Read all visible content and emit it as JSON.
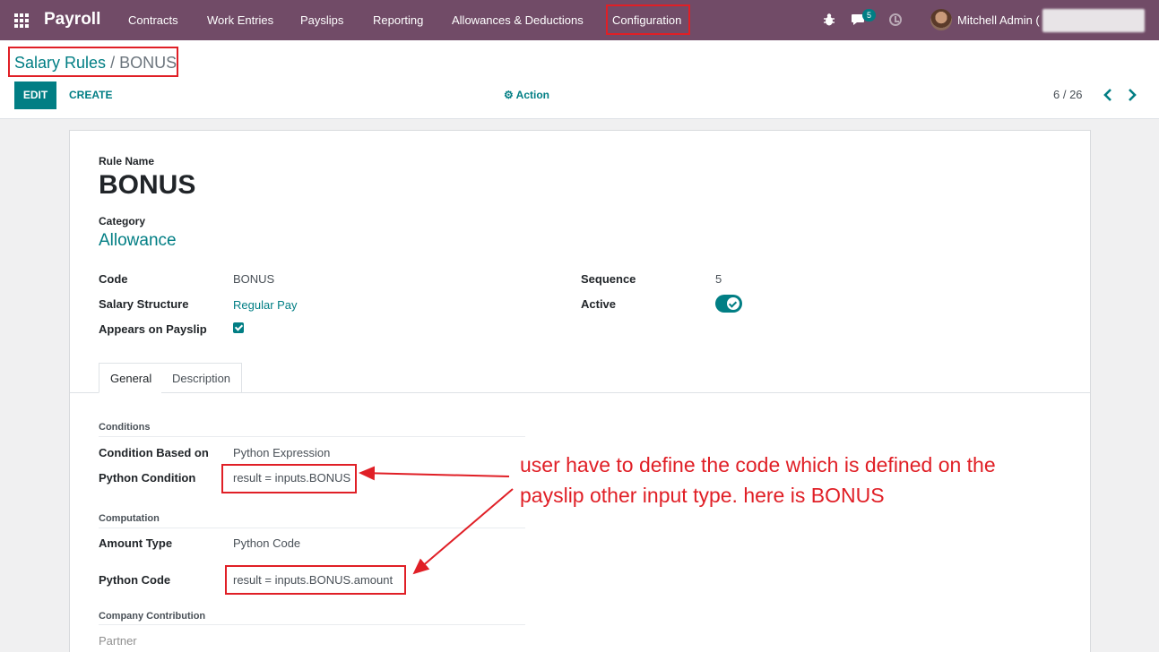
{
  "navbar": {
    "brand": "Payroll",
    "menu": [
      "Contracts",
      "Work Entries",
      "Payslips",
      "Reporting",
      "Allowances & Deductions",
      "Configuration"
    ],
    "message_count": "5",
    "user": "Mitchell Admin ("
  },
  "control_panel": {
    "breadcrumb_parent": "Salary Rules",
    "breadcrumb_sep": "/",
    "breadcrumb_current": "BONUS",
    "edit_label": "EDIT",
    "create_label": "CREATE",
    "action_label": "Action",
    "pager": "6 / 26"
  },
  "form": {
    "rule_name_label": "Rule Name",
    "rule_name": "BONUS",
    "category_label": "Category",
    "category": "Allowance",
    "code_label": "Code",
    "code": "BONUS",
    "structure_label": "Salary Structure",
    "structure": "Regular Pay",
    "appears_label": "Appears on Payslip",
    "appears_checked": true,
    "sequence_label": "Sequence",
    "sequence": "5",
    "active_label": "Active",
    "active": true
  },
  "tabs": [
    "General",
    "Description"
  ],
  "general": {
    "conditions_head": "Conditions",
    "condition_based_label": "Condition Based on",
    "condition_based": "Python Expression",
    "python_condition_label": "Python Condition",
    "python_condition": "result = inputs.BONUS",
    "computation_head": "Computation",
    "amount_type_label": "Amount Type",
    "amount_type": "Python Code",
    "python_code_label": "Python Code",
    "python_code": "result = inputs.BONUS.amount",
    "company_head": "Company Contribution",
    "partner_label": "Partner"
  },
  "annotation": {
    "line1": "user have to define the code which is defined on the",
    "line2": "payslip other input type. here is BONUS"
  },
  "colors": {
    "navbar": "#714b67",
    "accent": "#017e84",
    "highlight": "#e01f26"
  }
}
